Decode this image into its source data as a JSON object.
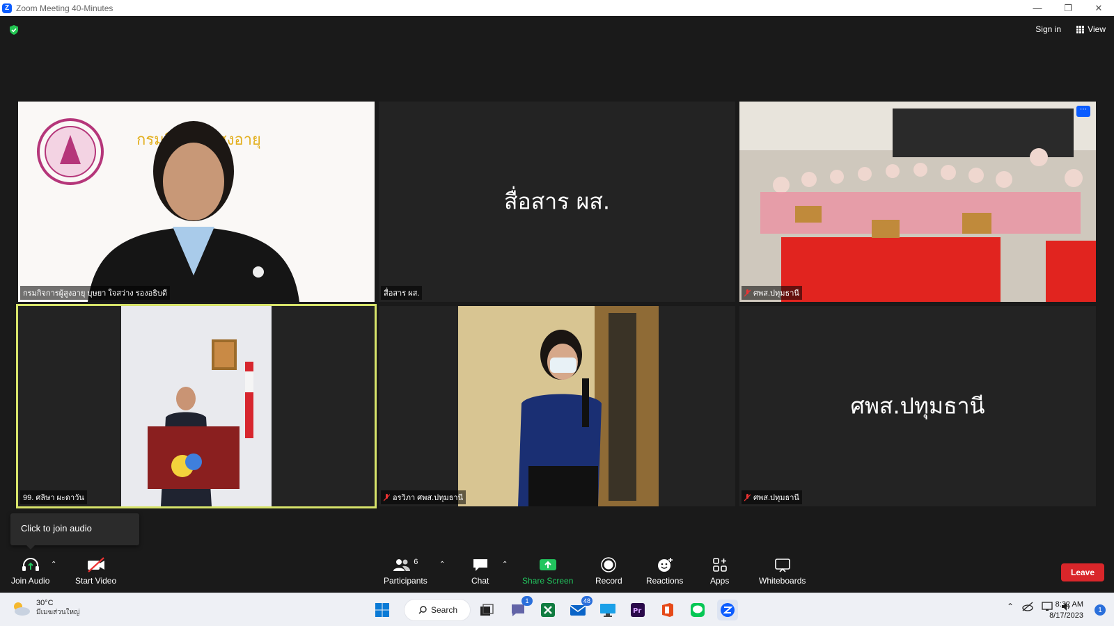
{
  "window": {
    "title": "Zoom Meeting 40-Minutes"
  },
  "header": {
    "signin_label": "Sign in",
    "view_label": "View"
  },
  "tiles": [
    {
      "name": "กรมกิจการผู้สูงอายุ บุษยา ใจสว่าง รองอธิบดี",
      "display_text": "",
      "muted": false,
      "has_video": true,
      "bg_text": "กรมกิจการผู้สูงอายุ"
    },
    {
      "name": "สื่อสาร ผส.",
      "display_text": "สื่อสาร ผส.",
      "muted": false,
      "has_video": false
    },
    {
      "name": "ศพส.ปทุมธานี",
      "display_text": "",
      "muted": true,
      "has_video": true
    },
    {
      "name": "99. ศลิษา ผะดาวัน",
      "display_text": "",
      "muted": false,
      "has_video": true,
      "active_speaker": true
    },
    {
      "name": "อรวิภา ศพส.ปทุมธานี",
      "display_text": "",
      "muted": true,
      "has_video": true
    },
    {
      "name": "ศพส.ปทุมธานี",
      "display_text": "ศพส.ปทุมธานี",
      "muted": true,
      "has_video": false
    }
  ],
  "tooltip": {
    "text": "Click to join audio"
  },
  "toolbar": {
    "join_audio": "Join Audio",
    "start_video": "Start Video",
    "participants": "Participants",
    "participants_count": "6",
    "chat": "Chat",
    "share_screen": "Share Screen",
    "record": "Record",
    "reactions": "Reactions",
    "apps": "Apps",
    "whiteboards": "Whiteboards",
    "leave": "Leave"
  },
  "taskbar": {
    "weather_temp": "30°C",
    "weather_cond": "มีเมฆส่วนใหญ่",
    "search_label": "Search",
    "teams_badge": "1",
    "mail_badge": "48",
    "time": "8:32 AM",
    "date": "8/17/2023",
    "notification_count": "1"
  },
  "colors": {
    "accent_green": "#22c55e",
    "leave_red": "#d9262a",
    "active_border": "#d7e36a",
    "zoom_blue": "#0b5cff"
  }
}
